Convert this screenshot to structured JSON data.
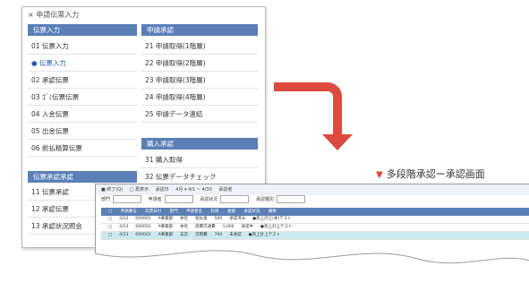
{
  "menu": {
    "title": "× 申請伝票入力",
    "sections": [
      {
        "header": "伝票入力",
        "items": [
          "01 伝票入力",
          "● 伝票入力",
          "02 承認伝票",
          "03 ｺﾞﾐ伝票伝票",
          "04 入金伝票",
          "05 出金伝票",
          "06 前払精算伝票"
        ]
      },
      {
        "header": "申請承認",
        "items": [
          "21 申請取得(1階層)",
          "22 申請取得(2階層)",
          "23 申請取得(3階層)",
          "24 申請取得(4階層)",
          "25 申請データ連結"
        ]
      },
      {
        "header": "購入承認",
        "items": [
          "31 購入取得",
          "32 伝票データチェック"
        ]
      },
      {
        "header": "伝票承認承認",
        "items": [
          "11 伝票承認",
          "12 承認伝票",
          "13 承認状況照会"
        ]
      }
    ]
  },
  "arrow": {
    "color": "#dd4b3f"
  },
  "caption": {
    "marker": "▼",
    "text": "多段階承認ー承認画面"
  },
  "approval": {
    "toolbar": [
      "■ 終了(Q)",
      "□ 再表示",
      "承認日",
      "4月 ▾ 4/1 ~ 4/30",
      "承認者"
    ],
    "filters": [
      "部門",
      "申請者",
      "承認状況",
      "承認種別"
    ],
    "columns": [
      "□",
      "申請番号",
      "伝票日付",
      "部門",
      "申請者名",
      "科目",
      "金額",
      "承認状況",
      "摘要"
    ],
    "rows": [
      [
        "□",
        "4/23",
        "000001",
        "A事業部",
        "本社",
        "仮払金",
        "500",
        "承認済み",
        "●売上計上(本)テスト"
      ],
      [
        "□",
        "4/23",
        "000002",
        "A事業部",
        "本社",
        "旅費交通費",
        "1,000",
        "承認中",
        "●売上計上テスト"
      ],
      [
        "□",
        "4/23",
        "000003",
        "A事業部",
        "支店",
        "交際費",
        "700",
        "未承認",
        "●売上計上テスト"
      ]
    ]
  }
}
